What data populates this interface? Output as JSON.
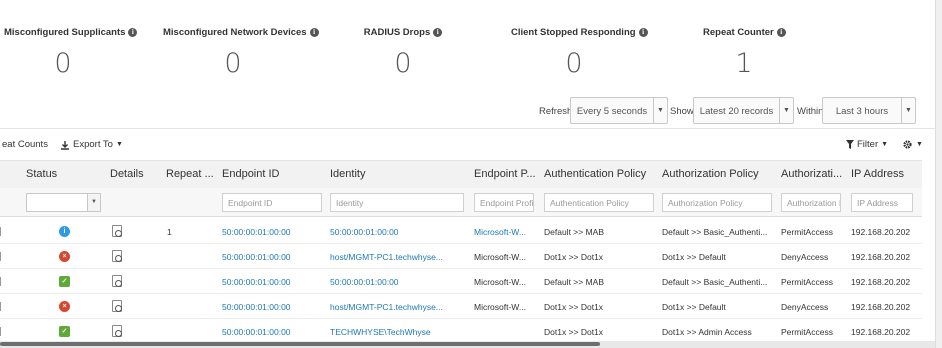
{
  "counters": [
    {
      "title": "Misconfigured Supplicants",
      "value": "0"
    },
    {
      "title": "Misconfigured Network Devices",
      "value": "0"
    },
    {
      "title": "RADIUS Drops",
      "value": "0"
    },
    {
      "title": "Client Stopped Responding",
      "value": "0"
    },
    {
      "title": "Repeat Counter",
      "value": "1"
    }
  ],
  "refresh_bar": {
    "refresh_label": "Refresh",
    "refresh_value": "Every 5 seconds",
    "show_label": "Show",
    "show_value": "Latest 20 records",
    "within_label": "Within",
    "within_value": "Last 3 hours"
  },
  "toolbar": {
    "repeat_counts": "eat Counts",
    "export": "Export To",
    "filter": "Filter"
  },
  "table": {
    "headers": [
      "Status",
      "Details",
      "Repeat ...",
      "Endpoint ID",
      "Identity",
      "Endpoint P...",
      "Authentication Policy",
      "Authorization Policy",
      "Authorizati...",
      "IP Address"
    ],
    "filter_placeholders": [
      "Endpoint ID",
      "Identity",
      "Endpoint Profil",
      "Authentication Policy",
      "Authorization Policy",
      "Authorization F",
      "IP Address"
    ],
    "rows": [
      {
        "status": "info",
        "repeat": "1",
        "endpoint_id": "50:00:00:01:00:00",
        "identity": "50:00:00:01:00:00",
        "endpoint_profile": "Microsoft-W...",
        "authn_policy": "Default >> MAB",
        "authz_policy": "Default >> Basic_Authenti...",
        "authz_profile": "PermitAccess",
        "ip": "192.168.20.202"
      },
      {
        "status": "fail",
        "repeat": "",
        "endpoint_id": "50:00:00:01:00:00",
        "identity": "host/MGMT-PC1.techwhyse...",
        "endpoint_profile": "Microsoft-W...",
        "authn_policy": "Dot1x >> Dot1x",
        "authz_policy": "Dot1x >> Default",
        "authz_profile": "DenyAccess",
        "ip": "192.168.20.202"
      },
      {
        "status": "pass",
        "repeat": "",
        "endpoint_id": "50:00:00:01:00:00",
        "identity": "50:00:00:01:00:00",
        "endpoint_profile": "Microsoft-W...",
        "authn_policy": "Default >> MAB",
        "authz_policy": "Default >> Basic_Authenti...",
        "authz_profile": "PermitAccess",
        "ip": "192.168.20.202"
      },
      {
        "status": "fail",
        "repeat": "",
        "endpoint_id": "50:00:00:01:00:00",
        "identity": "host/MGMT-PC1.techwhyse...",
        "endpoint_profile": "Microsoft-W...",
        "authn_policy": "Dot1x >> Dot1x",
        "authz_policy": "Dot1x >> Default",
        "authz_profile": "DenyAccess",
        "ip": "192.168.20.202"
      },
      {
        "status": "pass",
        "repeat": "",
        "endpoint_id": "50:00:00:01:00:00",
        "identity": "TECHWHYSE\\TechWhyse",
        "endpoint_profile": "",
        "authn_policy": "Dot1x >> Dot1x",
        "authz_policy": "Dot1x >> Admin Access",
        "authz_profile": "PermitAccess",
        "ip": "192.168.20.202"
      }
    ]
  },
  "colors": {
    "link": "#1f78b4",
    "status_info": "#2e9be0",
    "status_fail": "#d9462f",
    "status_pass": "#5faa36"
  }
}
